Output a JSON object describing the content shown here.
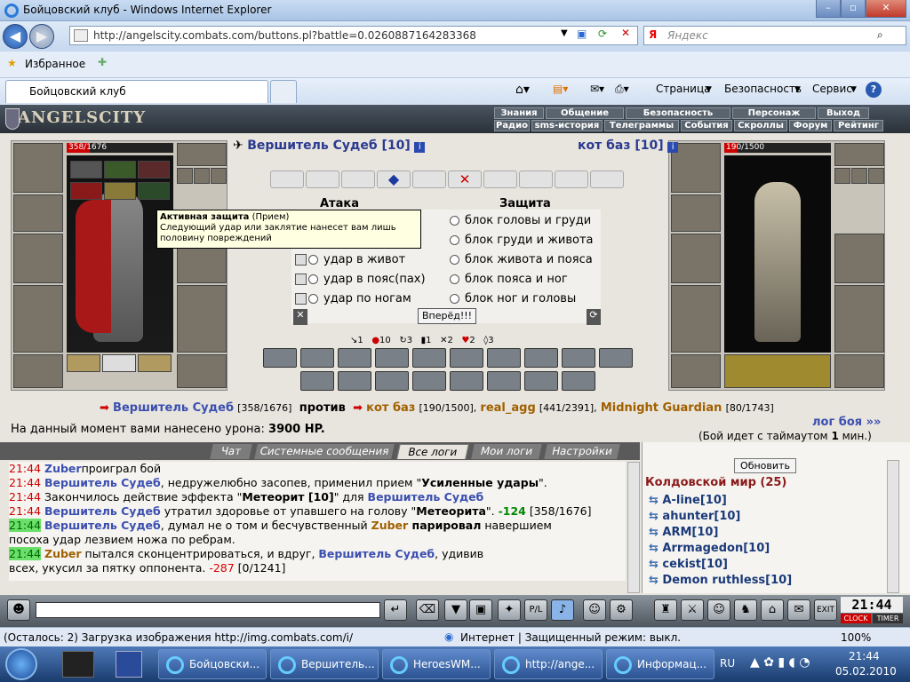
{
  "window": {
    "title": "Бойцовский клуб - Windows Internet Explorer"
  },
  "address": {
    "url": "http://angelscity.combats.com/buttons.pl?battle=0.0260887164283368",
    "search_placeholder": "Яндекс"
  },
  "favorites": {
    "label": "Избранное"
  },
  "tab": {
    "label": "Бойцовский клуб"
  },
  "commands": {
    "page": "Страница",
    "security": "Безопасность",
    "service": "Сервис"
  },
  "game": {
    "logo": "ANGELSCITY",
    "menu_top": [
      "Знания",
      "Общение",
      "Безопасность",
      "Персонаж",
      "Выход"
    ],
    "menu_bottom": [
      "Радио",
      "sms-история",
      "Телеграммы",
      "События",
      "Скроллы",
      "Форум",
      "Рейтинг"
    ],
    "player": {
      "name": "Вершитель Судеб [10]",
      "hp": "358/1676"
    },
    "enemy": {
      "name": "кот баз [10]",
      "hp": "190/1500"
    },
    "attack_title": "Атака",
    "defense_title": "Защита",
    "attacks": [
      "удар в живот",
      "удар в пояс(пах)",
      "удар по ногам"
    ],
    "blocks": [
      "блок головы и груди",
      "блок груди и живота",
      "блок живота и пояса",
      "блок пояса и ног",
      "блок ног и головы"
    ],
    "go_button": "Вперёд!!!",
    "tooltip": {
      "title": "Активная защита",
      "type": "(Прием)",
      "text": "Следующий удар или заклятие нанесет вам лишь половину повреждений"
    },
    "stats": [
      "1",
      "10",
      "3",
      "1",
      "2",
      "2",
      "3"
    ],
    "versus": {
      "p1": "Вершитель Судеб",
      "p1_hp": "[358/1676]",
      "vs": "против",
      "e1": "кот баз",
      "e1_hp": "[190/1500],",
      "e2": "real_agg",
      "e2_hp": "[441/2391],",
      "e3": "Midnight Guardian",
      "e3_hp": "[80/1743]"
    },
    "damage_text": "На данный момент вами нанесено урона:",
    "damage_value": "3900 HP.",
    "log_link": "лог боя »»",
    "timeout": "(Бой идет с таймаутом",
    "timeout_n": "1",
    "timeout_unit": "мин.)",
    "log_tabs": [
      "Чат",
      "Системные сообщения",
      "Все логи",
      "Мои логи",
      "Настройки"
    ],
    "refresh": "Обновить",
    "room": "Колдовской мир (25)",
    "users": [
      "A-line[10]",
      "ahunter[10]",
      "ARM[10]",
      "Arrmagedon[10]",
      "cekist[10]",
      "Demon ruthless[10]"
    ],
    "clock": "21:44",
    "clock_label": "CLOCK",
    "timer_label": "TIMER"
  },
  "log": [
    {
      "time": "21:44",
      "parts": [
        [
          "blue",
          "Zuber"
        ],
        [
          "",
          "проиграл бой"
        ]
      ]
    },
    {
      "time": "21:44",
      "parts": [
        [
          "blue",
          "Вершитель Судеб"
        ],
        [
          "",
          ", недружелюбно засопев, применил прием \""
        ],
        [
          "b",
          "Усиленные удары"
        ],
        [
          "",
          "\"."
        ]
      ]
    },
    {
      "time": "21:44",
      "parts": [
        [
          "",
          "Закончилось действие эффекта \""
        ],
        [
          "b",
          "Метеорит [10]"
        ],
        [
          "",
          "\" для "
        ],
        [
          "blue",
          "Вершитель Судеб"
        ]
      ]
    },
    {
      "time": "21:44",
      "parts": [
        [
          "blue",
          "Вершитель Судеб"
        ],
        [
          "",
          " утратил здоровье от упавшего на голову \""
        ],
        [
          "b",
          "Метеорита"
        ],
        [
          "",
          "\". "
        ],
        [
          "grn",
          "-124"
        ],
        [
          "",
          " [358/1676]"
        ]
      ]
    },
    {
      "time": "21:44",
      "parts": [
        [
          "blue",
          "Вершитель Судеб"
        ],
        [
          "",
          ", думал не о том и бесчувственный "
        ],
        [
          "brown",
          "Zuber"
        ],
        [
          "b",
          " парировал"
        ],
        [
          "",
          " навершием"
        ]
      ]
    },
    {
      "time": "",
      "parts": [
        [
          "",
          "посоха удар лезвием ножа по ребрам."
        ]
      ]
    },
    {
      "time": "21:44",
      "parts": [
        [
          "brown",
          "Zuber"
        ],
        [
          "",
          " пытался сконцентрироваться, и вдруг, "
        ],
        [
          "blue",
          "Вершитель Судеб"
        ],
        [
          "",
          ", удивив"
        ]
      ]
    },
    {
      "time": "",
      "parts": [
        [
          "",
          "всех, укусил за пятку оппонента. "
        ],
        [
          "red",
          "-287"
        ],
        [
          "",
          " [0/1241]"
        ]
      ]
    }
  ],
  "status": {
    "text": "(Осталось: 2) Загрузка изображения http://img.combats.com/i/",
    "zone": "Интернет | Защищенный режим: выкл.",
    "zoom": "100%"
  },
  "taskbar": {
    "items": [
      "Бойцовски...",
      "Вершитель...",
      "HeroesWM...",
      "http://ange...",
      "Информац..."
    ],
    "lang": "RU",
    "time": "21:44",
    "date": "05.02.2010"
  }
}
